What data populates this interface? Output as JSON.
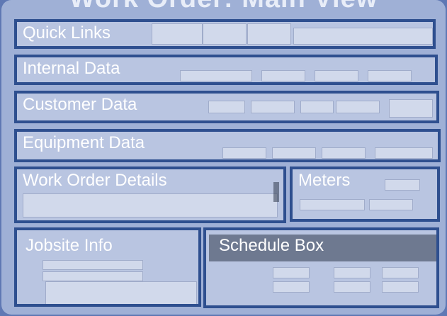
{
  "title": "Work Order: Main View",
  "panels": {
    "quick_links": "Quick Links",
    "internal_data": "Internal Data",
    "customer_data": "Customer Data",
    "equipment_data": "Equipment Data",
    "work_order_details": "Work Order Details",
    "meters": "Meters",
    "jobsite_info": "Jobsite Info",
    "schedule_box": "Schedule Box"
  }
}
